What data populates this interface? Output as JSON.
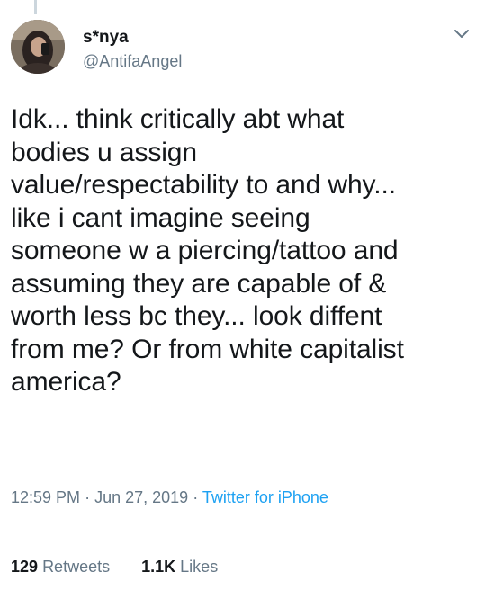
{
  "user": {
    "display_name": "s*nya",
    "handle": "@AntifaAngel"
  },
  "tweet": {
    "text": "Idk... think critically abt what\nbodies u assign\nvalue/respectability to and why...\nlike i cant imagine seeing\nsomeone w a piercing/tattoo and\nassuming they are capable of &\nworth less bc they... look diffent\nfrom me? Or from white capitalist\namerica?",
    "time": "12:59 PM",
    "date": "Jun 27, 2019",
    "separator": "·",
    "source": "Twitter for iPhone"
  },
  "stats": {
    "retweets_count": "129",
    "retweets_label": "Retweets",
    "likes_count": "1.1K",
    "likes_label": "Likes"
  },
  "colors": {
    "text": "#14171a",
    "secondary": "#657786",
    "link": "#1da1f2",
    "divider": "#e6ecf0"
  },
  "icons": {
    "more": "chevron-down-icon"
  }
}
